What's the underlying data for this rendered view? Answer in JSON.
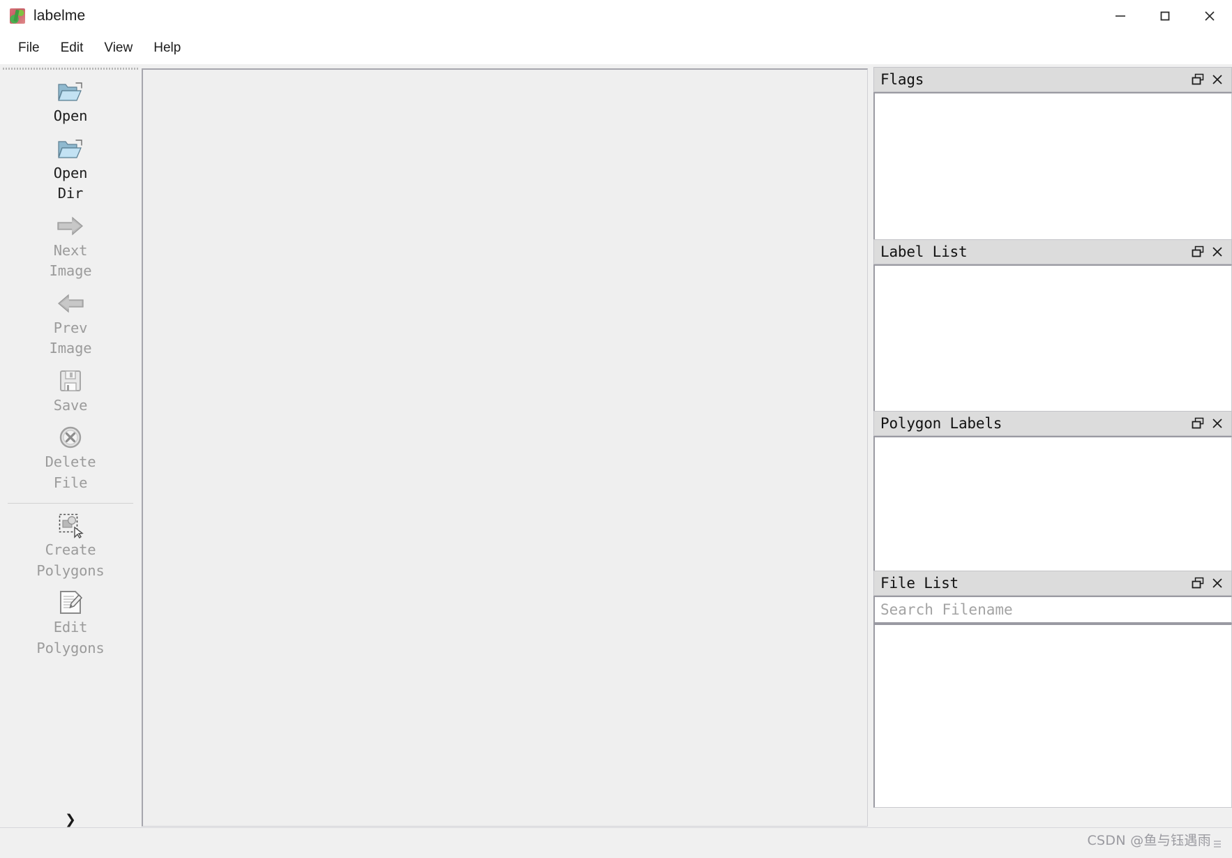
{
  "window": {
    "title": "labelme",
    "app_icon": "labelme-logo-icon",
    "controls": {
      "minimize": "minimize-icon",
      "maximize": "maximize-icon",
      "close": "close-icon"
    }
  },
  "menubar": {
    "items": [
      {
        "label": "File"
      },
      {
        "label": "Edit"
      },
      {
        "label": "View"
      },
      {
        "label": "Help"
      }
    ]
  },
  "toolbar": {
    "handle": "toolbar-drag-handle",
    "overflow_label": "»",
    "items": [
      {
        "label": "Open",
        "icon": "open-folder-icon",
        "enabled": true,
        "separator_after": false
      },
      {
        "label": "Open\nDir",
        "icon": "open-folder-icon",
        "enabled": true,
        "separator_after": false
      },
      {
        "label": "Next\nImage",
        "icon": "arrow-right-icon",
        "enabled": false,
        "separator_after": false
      },
      {
        "label": "Prev\nImage",
        "icon": "arrow-left-icon",
        "enabled": false,
        "separator_after": false
      },
      {
        "label": "Save",
        "icon": "floppy-disk-icon",
        "enabled": false,
        "separator_after": false
      },
      {
        "label": "Delete\nFile",
        "icon": "delete-circle-x-icon",
        "enabled": false,
        "separator_after": true
      },
      {
        "label": "Create\nPolygons",
        "icon": "create-polygon-icon",
        "enabled": false,
        "separator_after": false
      },
      {
        "label": "Edit\nPolygons",
        "icon": "edit-polygon-icon",
        "enabled": false,
        "separator_after": false
      }
    ]
  },
  "canvas": {
    "content": "",
    "background_color": "#efefef"
  },
  "docks": [
    {
      "title": "Flags",
      "float_icon": "float-window-icon",
      "close_icon": "close-icon",
      "items": [],
      "search": null
    },
    {
      "title": "Label List",
      "float_icon": "float-window-icon",
      "close_icon": "close-icon",
      "items": [],
      "search": null
    },
    {
      "title": "Polygon Labels",
      "float_icon": "float-window-icon",
      "close_icon": "close-icon",
      "items": [],
      "search": null
    },
    {
      "title": "File List",
      "float_icon": "float-window-icon",
      "close_icon": "close-icon",
      "items": [],
      "search": {
        "value": "",
        "placeholder": "Search Filename"
      }
    }
  ],
  "statusbar": {
    "text": ""
  },
  "watermark": {
    "text": "CSDN @鱼与钰遇雨"
  },
  "colors": {
    "window_bg": "#f0f0f0",
    "titlebar_bg": "#ffffff",
    "dock_title_bg": "#dcdcdc",
    "panel_bg": "#ffffff",
    "canvas_bg": "#efefef",
    "disabled_text": "#9b9b9b",
    "text": "#1c1c1c",
    "watermark_text": "#9a9aa0"
  }
}
